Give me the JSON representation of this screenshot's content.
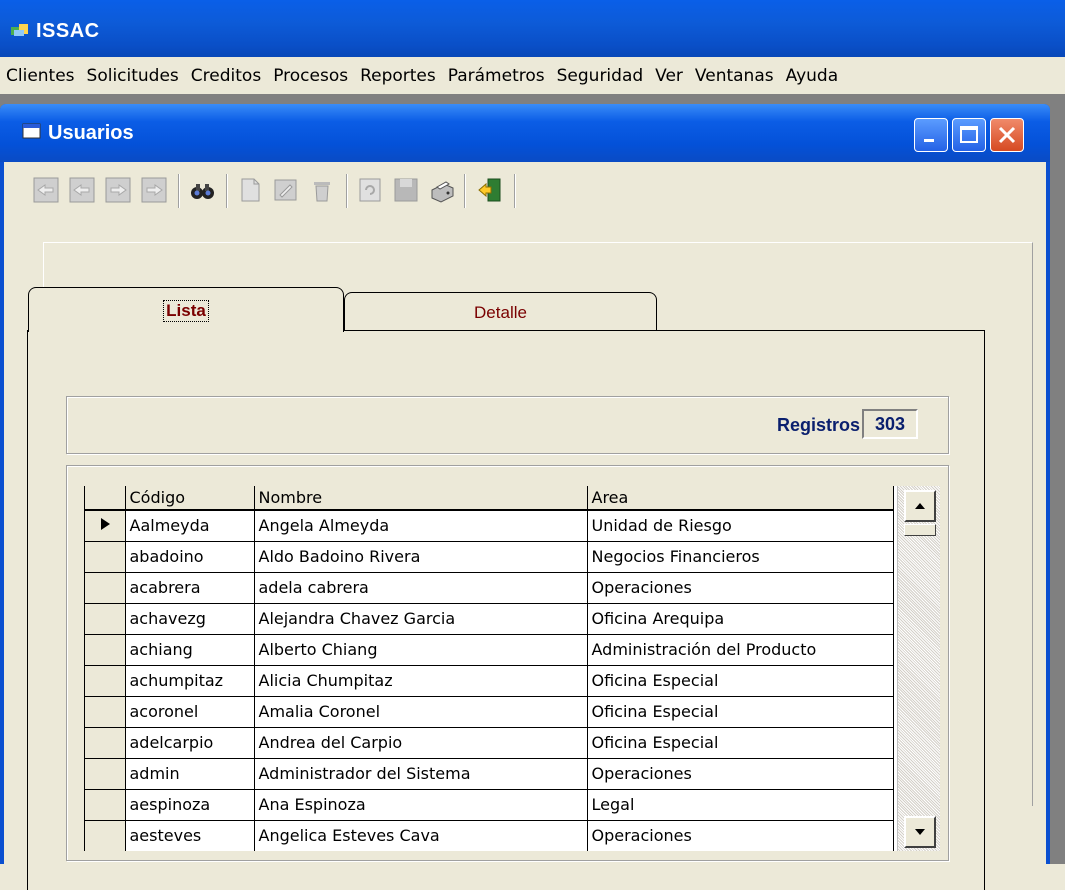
{
  "app": {
    "title": "ISSAC"
  },
  "menu": [
    "Clientes",
    "Solicitudes",
    "Creditos",
    "Procesos",
    "Reportes",
    "Parámetros",
    "Seguridad",
    "Ver",
    "Ventanas",
    "Ayuda"
  ],
  "window": {
    "title": "Usuarios"
  },
  "tabs": {
    "lista": "Lista",
    "detalle": "Detalle"
  },
  "registros": {
    "label": "Registros",
    "count": "303"
  },
  "grid": {
    "columns": [
      "Código",
      "Nombre",
      "Area"
    ],
    "rows": [
      [
        "Aalmeyda",
        "Angela Almeyda",
        "Unidad de Riesgo"
      ],
      [
        "abadoino",
        "Aldo Badoino Rivera",
        "Negocios Financieros"
      ],
      [
        "acabrera",
        "adela cabrera",
        "Operaciones"
      ],
      [
        "achavezg",
        "Alejandra Chavez Garcia",
        "Oficina Arequipa"
      ],
      [
        "achiang",
        "Alberto Chiang",
        "Administración del Producto"
      ],
      [
        "achumpitaz",
        "Alicia Chumpitaz",
        "Oficina Especial"
      ],
      [
        "acoronel",
        "Amalia Coronel",
        "Oficina Especial"
      ],
      [
        "adelcarpio",
        "Andrea del Carpio",
        "Oficina Especial"
      ],
      [
        "admin",
        "Administrador del Sistema",
        "Operaciones"
      ],
      [
        "aespinoza",
        "Ana Espinoza",
        "Legal"
      ],
      [
        "aesteves",
        "Angelica Esteves Cava",
        "Operaciones"
      ]
    ]
  },
  "colors": {
    "titlebar": "#0a5fe8",
    "tab_text": "#7a0000",
    "registros_text": "#0a1f6e"
  }
}
